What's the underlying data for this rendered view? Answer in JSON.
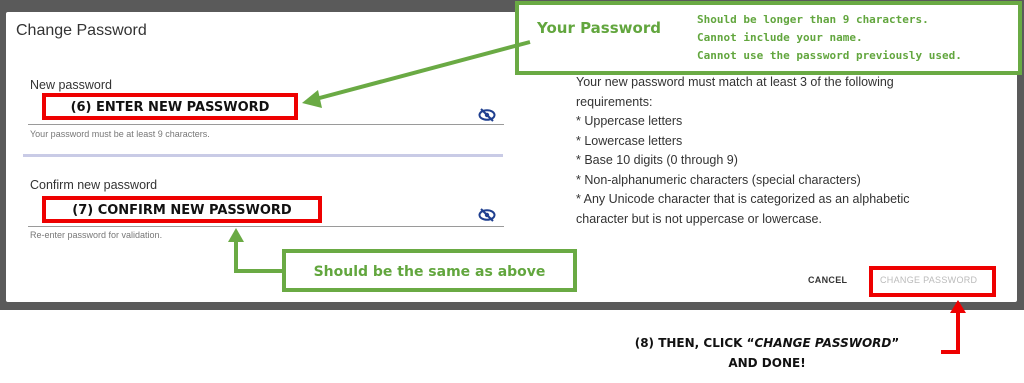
{
  "dialog": {
    "title": "Change Password",
    "new_password": {
      "label": "New password",
      "helper": "Your password must be at least 9 characters."
    },
    "confirm_password": {
      "label": "Confirm new password",
      "helper": "Re-enter password for validation."
    },
    "requirements": [
      "Your new password must match at least 3 of the following",
      "requirements:",
      "* Uppercase letters",
      "* Lowercase letters",
      "* Base 10 digits (0 through 9)",
      "* Non-alphanumeric characters (special characters)",
      "* Any Unicode character that is categorized as an alphabetic",
      "character but is not uppercase or lowercase."
    ],
    "cancel_label": "CANCEL",
    "change_label": "CHANGE PASSWORD"
  },
  "annotations": {
    "step6": "(6) ENTER NEW PASSWORD",
    "step7": "(7) CONFIRM NEW PASSWORD",
    "your_password_title": "Your Password",
    "your_password_rules": [
      "Should be longer than 9 characters.",
      "Cannot include your name.",
      "Cannot use the password previously used."
    ],
    "same_as_above": "Should be the same as above",
    "step8_prefix": "(8) THEN, CLICK “",
    "step8_emph": "CHANGE PASSWORD",
    "step8_suffix": "”",
    "step8_line2": "AND DONE!"
  },
  "colors": {
    "annotation_red": "#ee0000",
    "annotation_green": "#6aaa44",
    "eye_icon": "#1f3f8f"
  }
}
